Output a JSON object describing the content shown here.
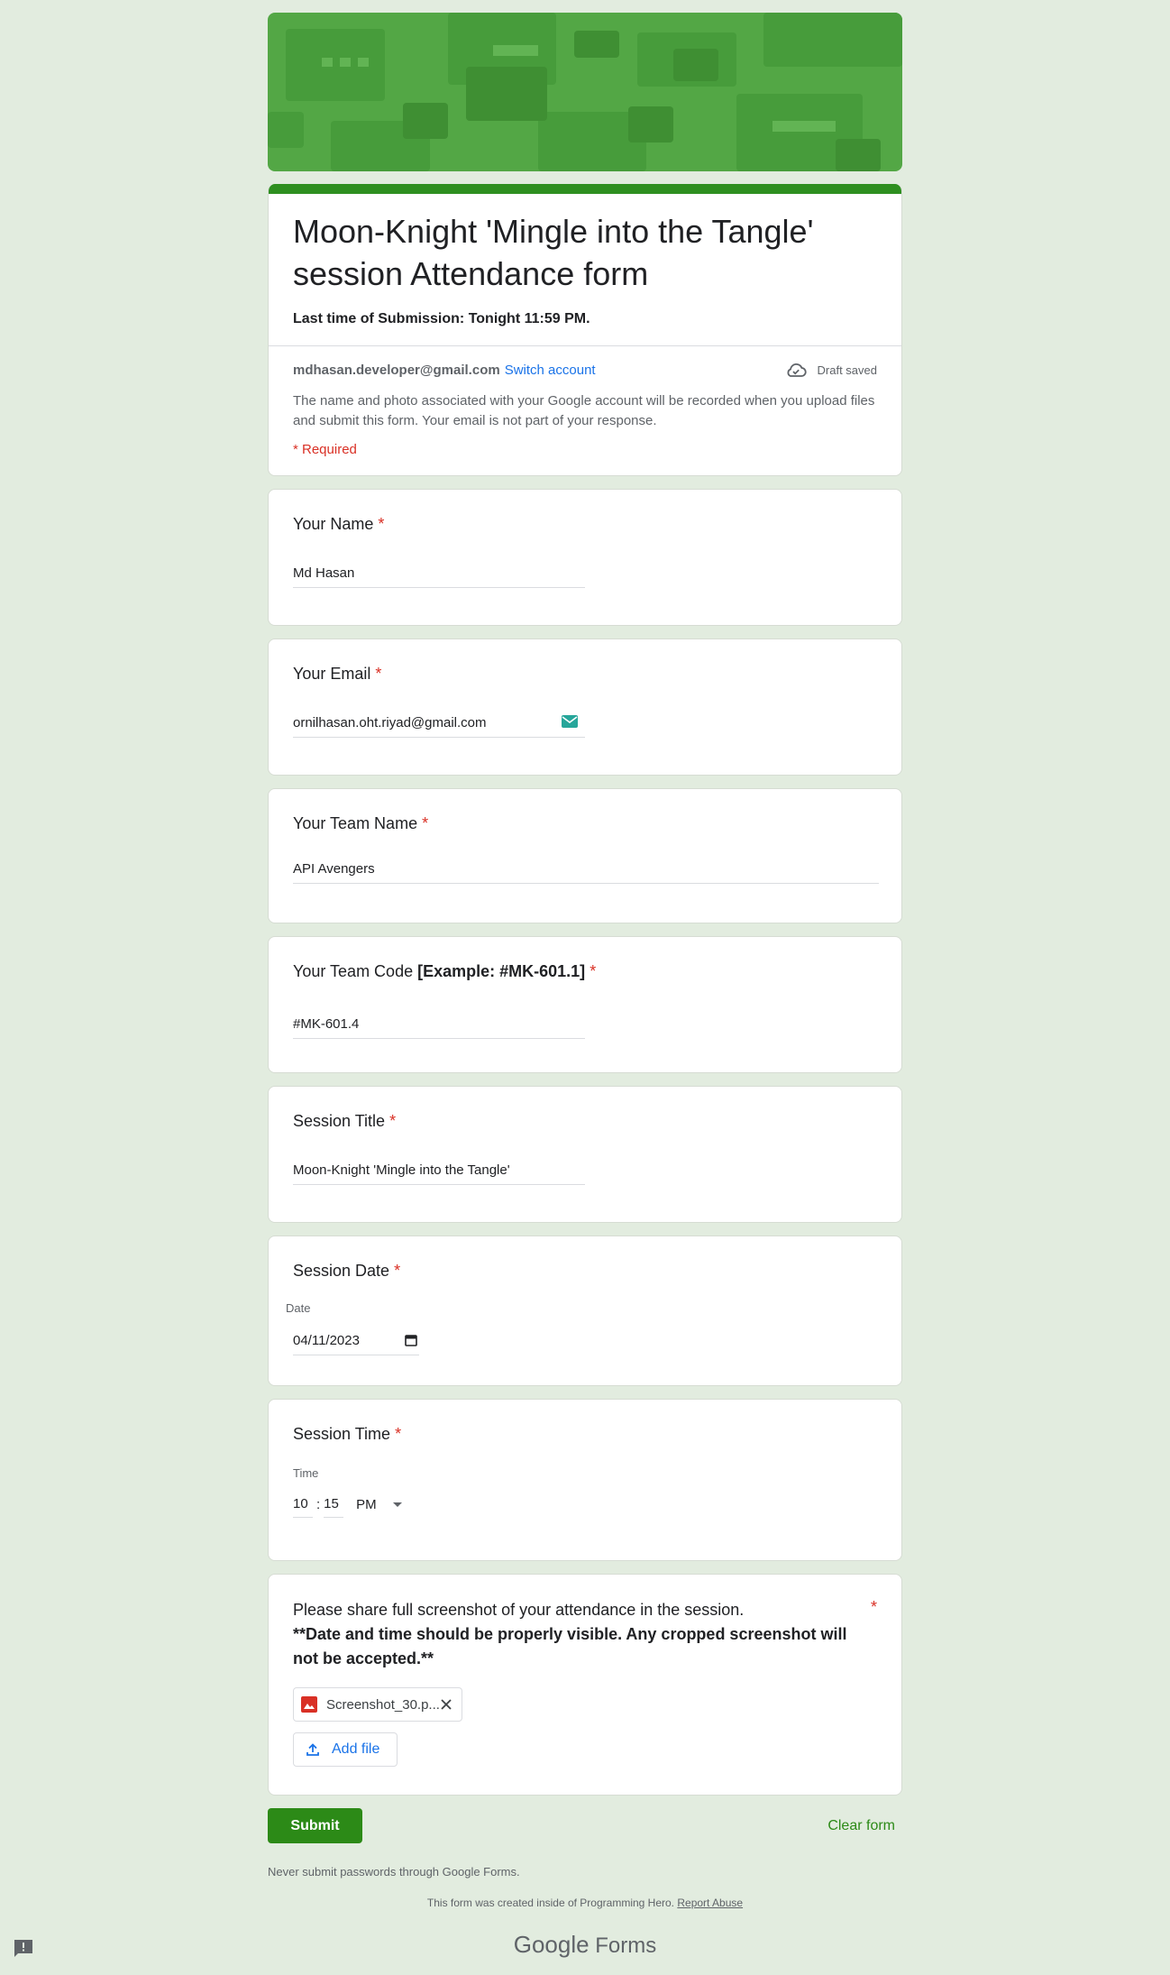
{
  "form": {
    "title": "Moon-Knight 'Mingle into the Tangle' session Attendance form",
    "description": "Last time of Submission: Tonight 11:59 PM.",
    "account_email": "mdhasan.developer@gmail.com",
    "switch_account": "Switch account",
    "draft_status": "Draft saved",
    "notice": "The name and photo associated with your Google account will be recorded when you upload files and submit this form. Your email is not part of your response.",
    "required_note": "* Required"
  },
  "questions": {
    "name": {
      "label": "Your Name",
      "star": "*",
      "value": "Md Hasan"
    },
    "email": {
      "label": "Your Email",
      "star": "*",
      "value": "ornilhasan.oht.riyad@gmail.com"
    },
    "team_name": {
      "label": "Your Team Name",
      "star": "*",
      "value": "API Avengers"
    },
    "team_code": {
      "label": "Your Team Code",
      "label_bold": "[Example: #MK-601.1]",
      "star": "*",
      "value": "#MK-601.4"
    },
    "session_title": {
      "label": "Session Title",
      "star": "*",
      "value": "Moon-Knight 'Mingle into the Tangle'"
    },
    "session_date": {
      "label": "Session Date",
      "star": "*",
      "sublabel": "Date",
      "value": "04/11/2023"
    },
    "session_time": {
      "label": "Session Time",
      "star": "*",
      "sublabel": "Time",
      "hour": "10",
      "separator": ":",
      "minute": "15",
      "ampm": "PM"
    },
    "screenshot": {
      "label": "Please share full screenshot of your attendance in the session.",
      "label_bold": "**Date and time should be properly visible. Any cropped screenshot will not be accepted.**",
      "star": "*",
      "file_name": "Screenshot_30.p...",
      "add_file": "Add file"
    }
  },
  "footer": {
    "submit": "Submit",
    "clear": "Clear form",
    "never": "Never submit passwords through Google Forms.",
    "created": "This form was created inside of Programming Hero.",
    "report": "Report Abuse",
    "brand_google": "Google",
    "brand_forms": "Forms"
  },
  "colors": {
    "accent": "#2e8f20",
    "background": "#e2ecdf",
    "required": "#d93025",
    "link": "#1a73e8"
  },
  "icons": [
    "cloud-check-icon",
    "email-autofill-icon",
    "calendar-icon",
    "dropdown-arrow-icon",
    "image-file-icon",
    "close-icon",
    "upload-icon",
    "feedback-icon"
  ]
}
